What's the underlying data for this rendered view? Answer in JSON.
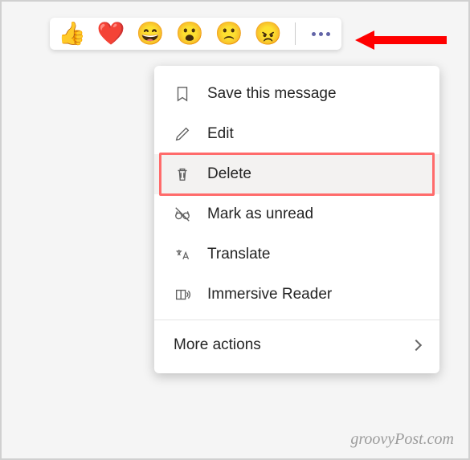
{
  "reactions": {
    "thumbs_up": "👍",
    "heart": "❤️",
    "laugh": "😄",
    "surprised": "😮",
    "sad": "🙁",
    "angry": "😠"
  },
  "menu": {
    "save": "Save this message",
    "edit": "Edit",
    "delete": "Delete",
    "mark_unread": "Mark as unread",
    "translate": "Translate",
    "immersive": "Immersive Reader",
    "more_actions": "More actions"
  },
  "watermark": "groovyPost.com"
}
